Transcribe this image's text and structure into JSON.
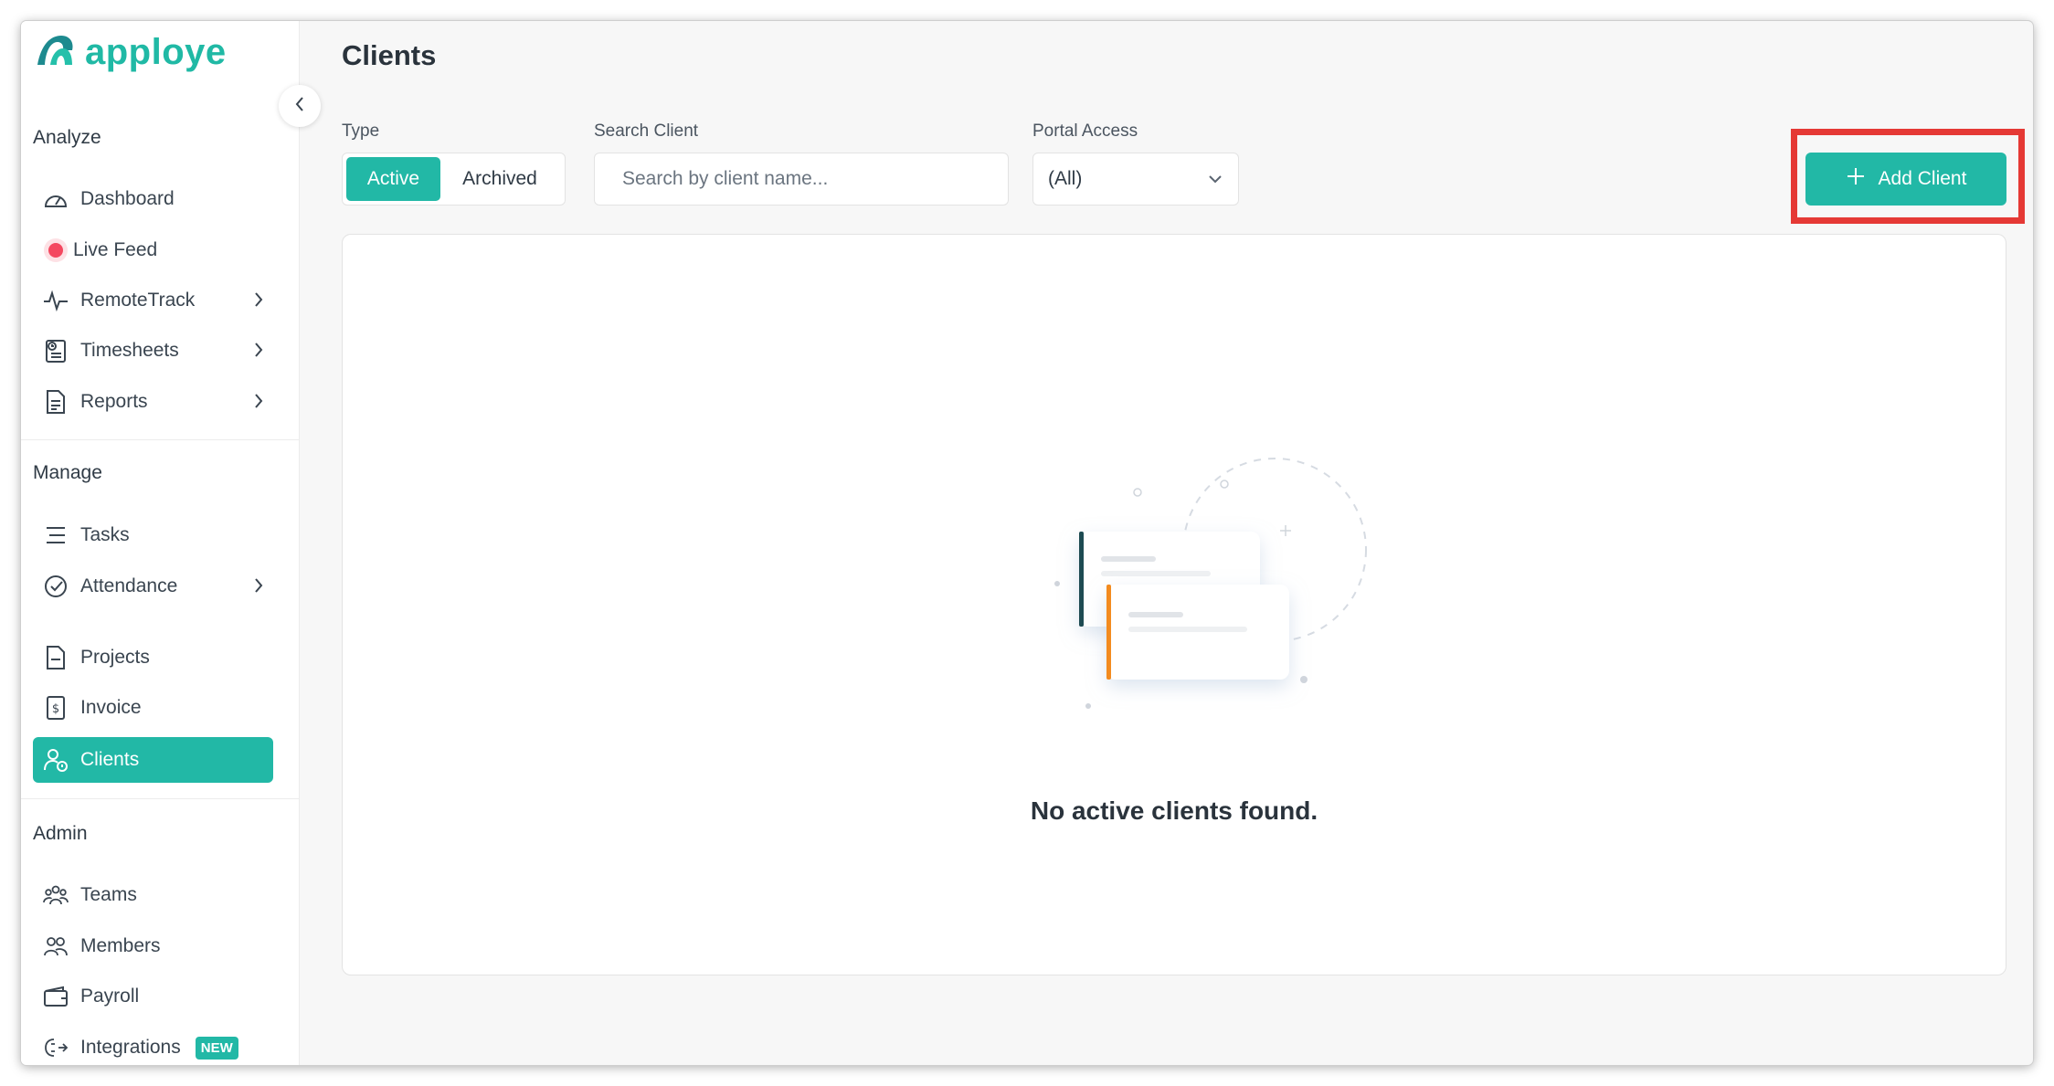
{
  "app": {
    "name": "apploye"
  },
  "sidebar": {
    "sections": {
      "analyze": "Analyze",
      "manage": "Manage",
      "admin": "Admin"
    },
    "items": {
      "dashboard": "Dashboard",
      "live_feed": "Live Feed",
      "remotetrack": "RemoteTrack",
      "timesheets": "Timesheets",
      "reports": "Reports",
      "tasks": "Tasks",
      "attendance": "Attendance",
      "projects": "Projects",
      "invoice": "Invoice",
      "clients": "Clients",
      "teams": "Teams",
      "members": "Members",
      "payroll": "Payroll",
      "integrations": "Integrations"
    },
    "badge_new": "NEW",
    "active_item": "clients"
  },
  "page": {
    "title": "Clients",
    "filters": {
      "type_label": "Type",
      "type_active": "Active",
      "type_archived": "Archived",
      "search_label": "Search Client",
      "search_placeholder": "Search by client name...",
      "portal_label": "Portal Access",
      "portal_value": "(All)"
    },
    "add_button": "Add Client",
    "empty_message": "No active clients found."
  },
  "colors": {
    "accent": "#22b8a6",
    "highlight": "#e53935",
    "live_dot": "#f44860"
  }
}
